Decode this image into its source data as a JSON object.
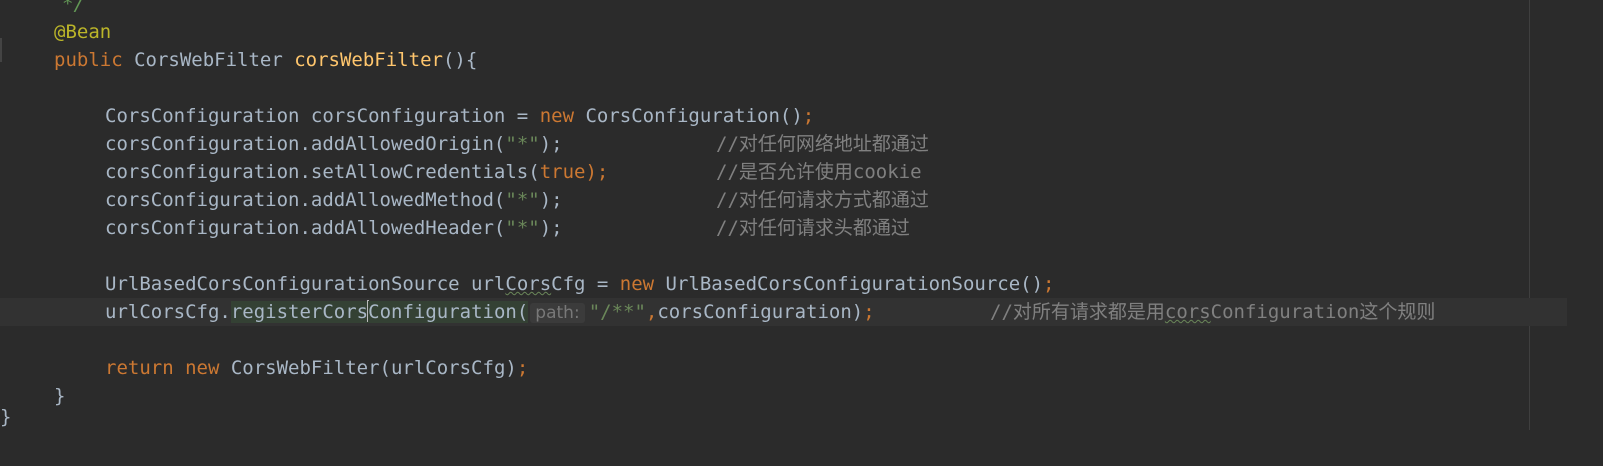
{
  "editor": {
    "lines": {
      "comment_end": "*/",
      "annotation": "@Bean",
      "method_kw": "public ",
      "method_type": "CorsWebFilter ",
      "method_name": "corsWebFilter",
      "method_paren": "(){",
      "l1_type": "CorsConfiguration corsConfiguration = ",
      "l1_new": "new ",
      "l1_ctor": "CorsConfiguration()",
      "l1_semi": ";",
      "l2_call": "corsConfiguration.addAllowedOrigin(",
      "l2_arg": "\"*\"",
      "l2_end": ");",
      "l2_cmt": "//对任何网络地址都通过",
      "l3_call": "corsConfiguration.setAllowCredentials(",
      "l3_arg": "true",
      "l3_end": ");",
      "l3_cmt": "//是否允许使用cookie",
      "l4_call": "corsConfiguration.addAllowedMethod(",
      "l4_arg": "\"*\"",
      "l4_end": ");",
      "l4_cmt": "//对任何请求方式都通过",
      "l5_call": "corsConfiguration.addAllowedHeader(",
      "l5_arg": "\"*\"",
      "l5_end": ");",
      "l5_cmt": "//对任何请求头都通过",
      "l6_type": "UrlBasedCorsConfigurationSource url",
      "l6_var_typo": "Cors",
      "l6_var_rest": "Cfg = ",
      "l6_new": "new ",
      "l6_ctor": "UrlBasedCorsConfigurationSource()",
      "l6_semi": ";",
      "l7_obj": "urlCorsCfg.",
      "l7_method_a": "registerCors",
      "l7_method_b": "Configuration",
      "l7_paren": "(",
      "l7_hint": "path:",
      "l7_arg": "\"/**\"",
      "l7_comma": ",",
      "l7_rest": "corsConfiguration)",
      "l7_semi": ";",
      "l7_cmt_a": "//对所有请求都是用",
      "l7_cmt_typo": "cors",
      "l7_cmt_b": "Configuration这个规则",
      "l8_return": "return ",
      "l8_new": "new ",
      "l8_ctor": "CorsWebFilter(urlCorsCfg)",
      "l8_semi": ";",
      "close_brace": "}",
      "outer_close": "}"
    }
  },
  "colors": {
    "background": "#2b2b2b",
    "keyword": "#cc7832",
    "function": "#ffc66d",
    "annotation": "#bbb529",
    "string": "#6a8759",
    "comment": "#808080",
    "text": "#a9b7c6"
  }
}
